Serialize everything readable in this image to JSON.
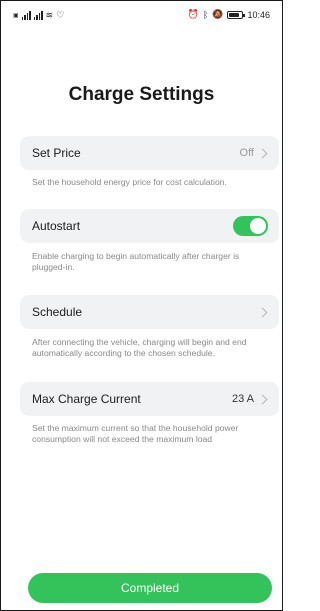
{
  "status_bar": {
    "left_text": "4G 4G",
    "time": "10:46",
    "icons": [
      "sim-icon",
      "signal-icon",
      "signal-icon",
      "wifi-icon",
      "data-icon",
      "alarm-icon",
      "bluetooth-icon",
      "mute-icon",
      "battery-icon"
    ]
  },
  "page": {
    "title": "Charge Settings"
  },
  "settings": {
    "set_price": {
      "label": "Set Price",
      "value": "Off",
      "description": "Set the household energy price for cost calculation."
    },
    "autostart": {
      "label": "Autostart",
      "enabled": true,
      "description": "Enable charging to begin automatically after charger is plugged-in."
    },
    "schedule": {
      "label": "Schedule",
      "description": "After connecting the vehicle, charging will begin and end automatically according to the chosen schedule."
    },
    "max_charge_current": {
      "label": "Max Charge Current",
      "value": "23 A",
      "description": "Set the maximum current so that the household power consumption will not exceed the maximum load"
    }
  },
  "footer": {
    "completed_label": "Completed"
  },
  "colors": {
    "accent": "#33c35a",
    "row_bg": "#f1f2f4",
    "muted_text": "#8a8a8a"
  }
}
